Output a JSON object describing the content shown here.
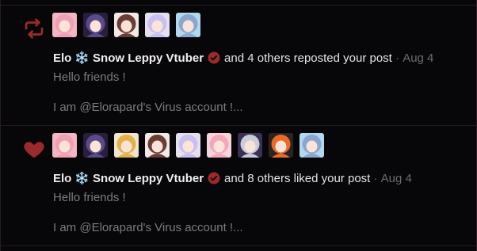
{
  "notifications": [
    {
      "type": "repost",
      "icon": "repost-icon",
      "icon_color": "#9b2a2a",
      "avatars": [
        {
          "name": "avatar-1",
          "bg": "#f4b6c3",
          "hair": "#f0a0b4"
        },
        {
          "name": "avatar-2",
          "bg": "#2a1e3e",
          "hair": "#5b4a8a"
        },
        {
          "name": "avatar-3",
          "bg": "#f2e8e6",
          "hair": "#6a3e34"
        },
        {
          "name": "avatar-4",
          "bg": "#e6e0ee",
          "hair": "#c7c0f0"
        },
        {
          "name": "avatar-5",
          "bg": "#b0d8ee",
          "hair": "#8aa6d0"
        }
      ],
      "user": "Elo",
      "snow": "❄️",
      "user2": "Snow Leppy Vtuber",
      "action": "and 4 others reposted your post",
      "sep": " · ",
      "date": "Aug 4",
      "preview_line1": "Hello friends !",
      "preview_line2": "I am @Elorapard's Virus account !..."
    },
    {
      "type": "like",
      "icon": "heart-icon",
      "icon_color": "#9b2a2a",
      "avatars": [
        {
          "name": "avatar-1",
          "bg": "#f4b6c3",
          "hair": "#f0a0b4"
        },
        {
          "name": "avatar-2",
          "bg": "#2a1e3e",
          "hair": "#5b4a8a"
        },
        {
          "name": "avatar-3",
          "bg": "#f0e4cf",
          "hair": "#e3b04a"
        },
        {
          "name": "avatar-4",
          "bg": "#f2e8e6",
          "hair": "#6a3e34"
        },
        {
          "name": "avatar-5",
          "bg": "#e6e0ee",
          "hair": "#c7c0f0"
        },
        {
          "name": "avatar-6",
          "bg": "#f7d4dc",
          "hair": "#f3a8ba"
        },
        {
          "name": "avatar-7",
          "bg": "#3a2f55",
          "hair": "#c9cdd8"
        },
        {
          "name": "avatar-8",
          "bg": "#2a2522",
          "hair": "#ea6a2a"
        },
        {
          "name": "avatar-9",
          "bg": "#b0d8ee",
          "hair": "#8aa6d0"
        }
      ],
      "user": "Elo",
      "snow": "❄️",
      "user2": "Snow Leppy Vtuber",
      "action": "and 8 others liked your post",
      "sep": " · ",
      "date": "Aug 4",
      "preview_line1": "Hello friends !",
      "preview_line2": "I am @Elorapard's Virus account !..."
    }
  ],
  "colors": {
    "background": "#070608",
    "accent": "#9b2a2a",
    "text": "#e7e3e5",
    "muted": "#7e7a80"
  }
}
